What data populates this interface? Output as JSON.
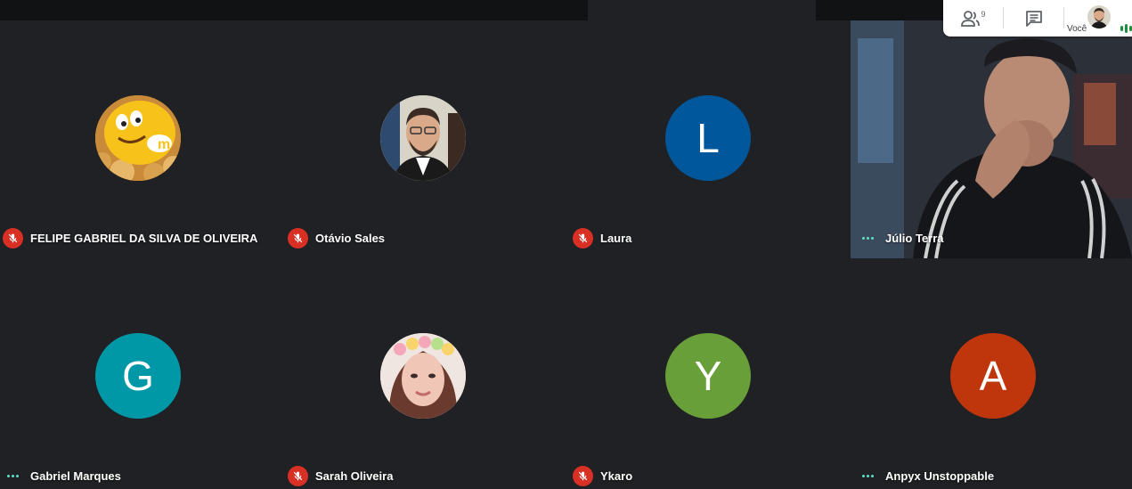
{
  "toolbar": {
    "participants_count": "9",
    "you_label": "Você"
  },
  "participants": [
    {
      "name": "FELIPE GABRIEL DA SILVA DE OLIVEIRA",
      "status": "muted",
      "avatar": "photo"
    },
    {
      "name": "Otávio Sales",
      "status": "muted",
      "avatar": "photo"
    },
    {
      "name": "Laura",
      "status": "muted",
      "initial": "L",
      "color": "#01579b"
    },
    {
      "name": "Júlio Terra",
      "status": "active",
      "avatar": "video"
    },
    {
      "name": "Gabriel Marques",
      "status": "active",
      "initial": "G",
      "color": "#0097a7"
    },
    {
      "name": "Sarah Oliveira",
      "status": "muted",
      "avatar": "photo"
    },
    {
      "name": "Ykaro",
      "status": "muted",
      "initial": "Y",
      "color": "#689f38"
    },
    {
      "name": "Anpyx Unstoppable",
      "status": "active",
      "initial": "A",
      "color": "#bf360c"
    }
  ],
  "colors": {
    "background": "#202124",
    "mic_off": "#d93025",
    "activity_dots": "#5fe0c4"
  }
}
